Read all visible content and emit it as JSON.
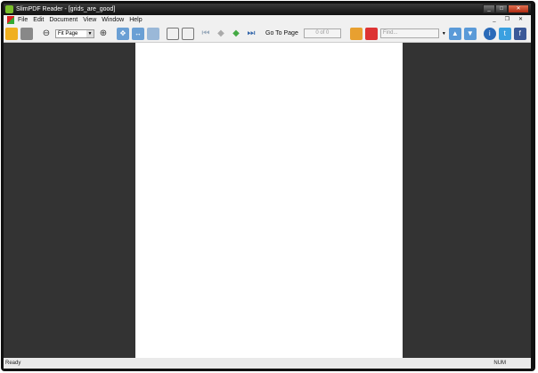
{
  "title": "SlimPDF Reader - [grids_are_good]",
  "menu": [
    "File",
    "Edit",
    "Document",
    "View",
    "Window",
    "Help"
  ],
  "toolbar": {
    "zoom_value": "Fit Page",
    "goto_label": "Go To Page",
    "page_indicator": "0 of 0",
    "find_placeholder": "Find..."
  },
  "status": {
    "left": "Ready",
    "right": "NUM"
  }
}
